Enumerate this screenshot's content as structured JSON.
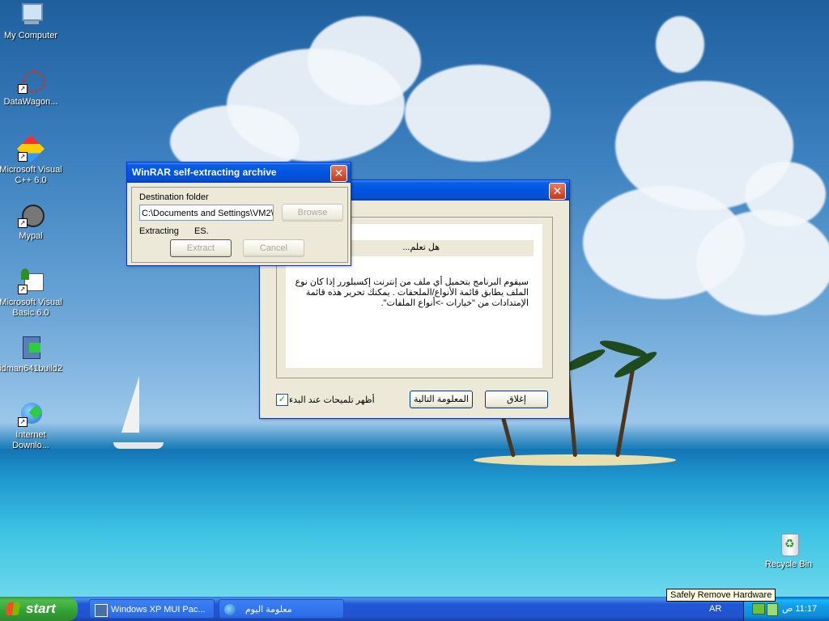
{
  "desktop": {
    "icons": [
      {
        "label": "My Computer"
      },
      {
        "label": "DataWagon..."
      },
      {
        "label": "Microsoft Visual C++ 6.0"
      },
      {
        "label": "Mypal"
      },
      {
        "label": "Microsoft Visual Basic 6.0"
      },
      {
        "label": "idman641build2"
      },
      {
        "label": "Internet Downlo..."
      },
      {
        "label": "Recycle Bin"
      }
    ]
  },
  "winrar": {
    "title": "WinRAR self-extracting archive",
    "destination_label": "Destination folder",
    "destination_value": "C:\\Documents and Settings\\VM2\\",
    "browse_label": "Browse",
    "extracting_label": "Extracting",
    "extracting_file": "ES.",
    "extract_label": "Extract",
    "cancel_label": "Cancel"
  },
  "tips": {
    "title": "",
    "heading": "هل تعلم...",
    "body": "سيقوم البرنامج بتحميل أي ملف من إنترنت إكسبلورر إذا كان نوع الملف يطابق قائمة الأنواع/الملحقات . يمكنك تحرير هذه قائمة الإمتدادات من \"خيارات ->أنواع الملفات\".",
    "show_tips_label": "أظهر تلميحات عند البدء",
    "show_tips_checked": true,
    "next_label": "المعلومة التالية",
    "close_label": "إغلاق"
  },
  "taskbar": {
    "start_label": "start",
    "tasks": [
      {
        "label": "Windows XP MUI Pac..."
      },
      {
        "label": "معلومة اليوم"
      }
    ],
    "language": "AR",
    "clock": "11:17 ص",
    "tooltip": "Safely Remove Hardware"
  },
  "colors": {
    "titlebar": "#0054e3",
    "dialog_bg": "#ece9d8",
    "taskbar": "#2353d0",
    "start_green": "#33a133"
  }
}
